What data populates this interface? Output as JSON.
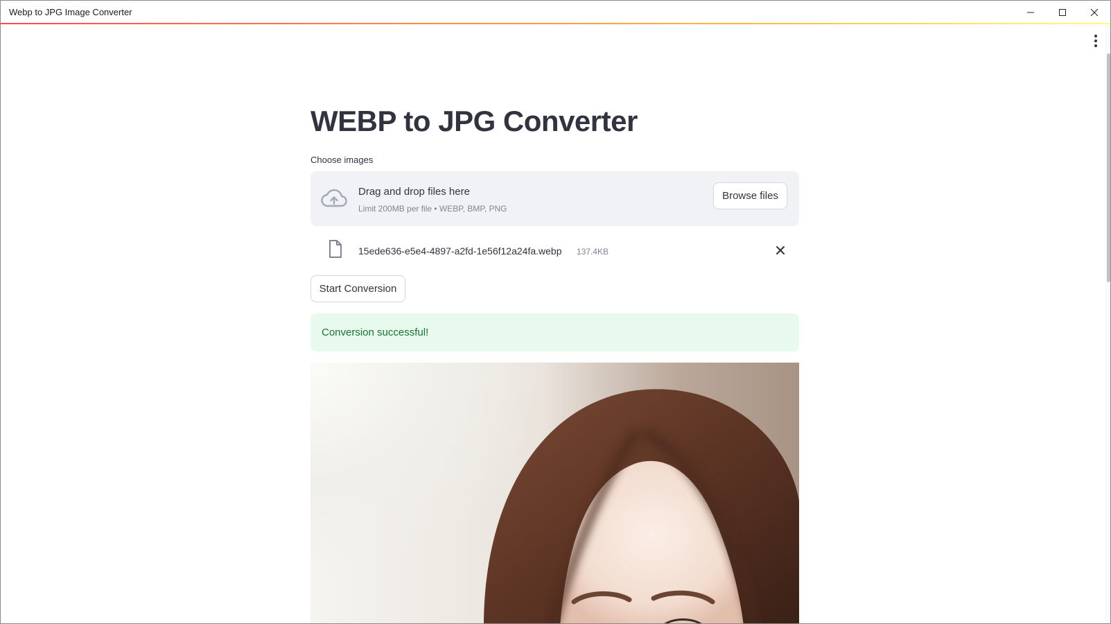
{
  "window": {
    "title": "Webp to JPG Image Converter"
  },
  "app": {
    "title": "WEBP to JPG Converter",
    "uploader": {
      "label": "Choose images",
      "drop_text": "Drag and drop files here",
      "limit_text": "Limit 200MB per file • WEBP, BMP, PNG",
      "browse_label": "Browse files"
    },
    "file": {
      "name": "15ede636-e5e4-4897-a2fd-1e56f12a24fa.webp",
      "size": "137.4KB"
    },
    "start_label": "Start Conversion",
    "success_message": "Conversion successful!"
  },
  "icons": {
    "upload": "cloud-upload-icon",
    "file": "file-icon",
    "remove": "close-icon",
    "menu": "kebab-menu-icon"
  },
  "colors": {
    "accent_start": "#ff4b4b",
    "accent_end": "#fffd80",
    "success_bg": "#e8f9ee",
    "success_text": "#177233"
  }
}
